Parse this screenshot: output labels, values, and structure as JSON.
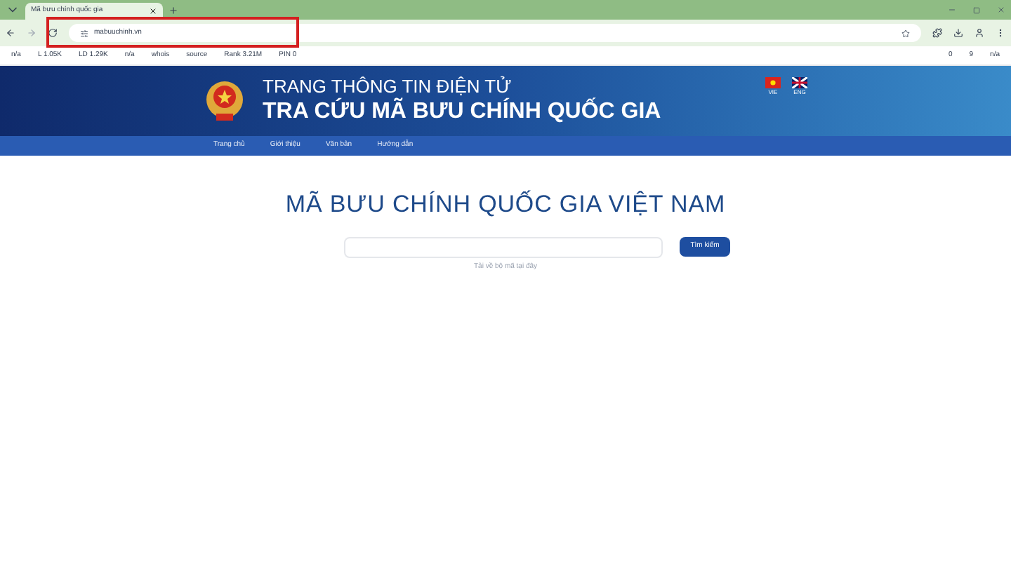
{
  "browser": {
    "tab_title": "Mã bưu chính quốc gia",
    "url": "mabuuchinh.vn",
    "highlight_url": true
  },
  "seo_bar": {
    "items": [
      "n/a",
      "L 1.05K",
      "LD 1.29K",
      "n/a",
      "whois",
      "source",
      "Rank 3.21M",
      "PIN 0"
    ],
    "right_items": [
      "0",
      "9",
      "n/a"
    ]
  },
  "header": {
    "subtitle": "TRANG THÔNG TIN ĐIỆN TỬ",
    "title": "TRA CỨU MÃ BƯU CHÍNH QUỐC GIA",
    "languages": [
      {
        "label": "VIE",
        "kind": "vn"
      },
      {
        "label": "ENG",
        "kind": "uk"
      }
    ]
  },
  "nav": [
    "Trang chủ",
    "Giới thiệu",
    "Văn bản",
    "Hướng dẫn"
  ],
  "main": {
    "heading": "MÃ BƯU CHÍNH QUỐC GIA VIỆT NAM",
    "search_button": "Tìm kiếm",
    "download_link": "Tải về bộ mã tại đây"
  }
}
